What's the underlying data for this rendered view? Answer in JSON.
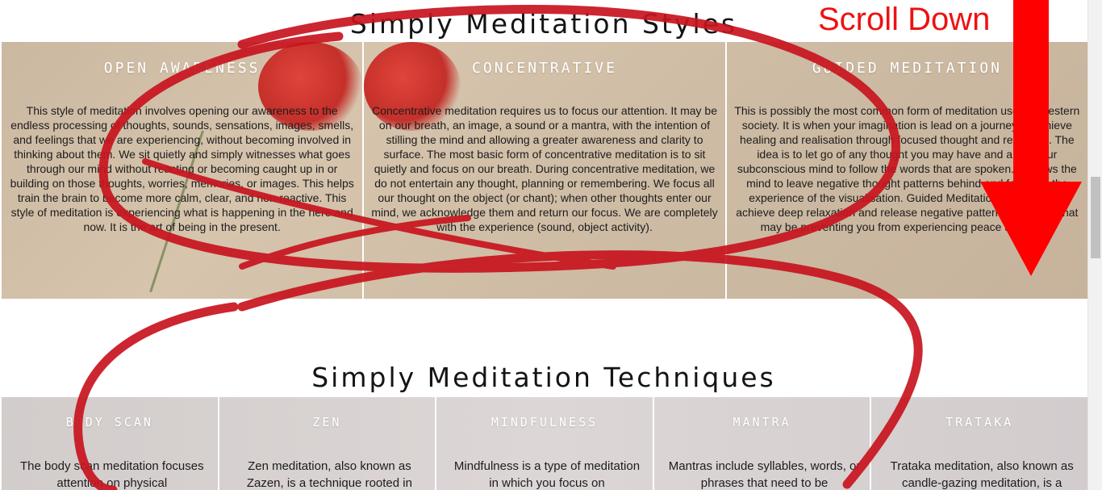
{
  "styles_section": {
    "title": "Simply Meditation Styles",
    "cards": [
      {
        "heading": "OPEN AWARENESS",
        "text": "This style of meditation involves opening our awareness to the endless processing of thoughts, sounds, sensations, images, smells, and feelings that we are experiencing, without becoming involved in thinking about them. We sit quietly and simply witnesses what goes through our mind without reacting or becoming caught up in or building on those thoughts, worries, memories, or images. This helps train the brain to become more calm, clear, and non-reactive. This style of meditation is experiencing what is happening in the here and now. It is the art of being in the present."
      },
      {
        "heading": "CONCENTRATIVE",
        "text": "Concentrative meditation requires us to focus our attention. It may be on our breath, an image, a sound or a mantra, with the intention of stilling the mind and allowing a greater awareness and clarity to surface. The most basic form of concentrative meditation is to sit quietly and focus on our breath. During concentrative meditation, we do not entertain any thought, planning or remembering. We focus all our thought on the object (or chant); when other thoughts enter our mind, we acknowledge them and return our focus. We are completely with the experience (sound, object activity)."
      },
      {
        "heading": "GUIDED MEDITATION",
        "text": "This is possibly the most common form of meditation used in western society. It is when your imagination is lead on a journey to achieve healing and realisation through focused thought and reflection. The idea is to let go of any thought you may have and allow your subconscious mind to follow the words that are spoken. It allows the mind to leave negative thought patterns behind and focus on the experience of the visualisation. Guided Meditation can help you achieve deep relaxation and release negative patterns or beliefs that may be preventing you from experiencing peace and calm."
      }
    ]
  },
  "techniques_section": {
    "title": "Simply Meditation Techniques",
    "cards": [
      {
        "heading": "BODY SCAN",
        "text": "The body scan meditation focuses attention on physical"
      },
      {
        "heading": "ZEN",
        "text": "Zen meditation, also known as Zazen, is a technique rooted in"
      },
      {
        "heading": "MINDFULNESS",
        "text": "Mindfulness is a type of meditation in which you focus on"
      },
      {
        "heading": "MANTRA",
        "text": "Mantras include syllables, words, or phrases that need to be"
      },
      {
        "heading": "TRATAKA",
        "text": "Trataka meditation, also known as candle-gazing meditation, is a"
      }
    ]
  },
  "annotation": {
    "label": "Scroll Down",
    "color": "#ee1111",
    "circle_color": "#c8141e"
  }
}
